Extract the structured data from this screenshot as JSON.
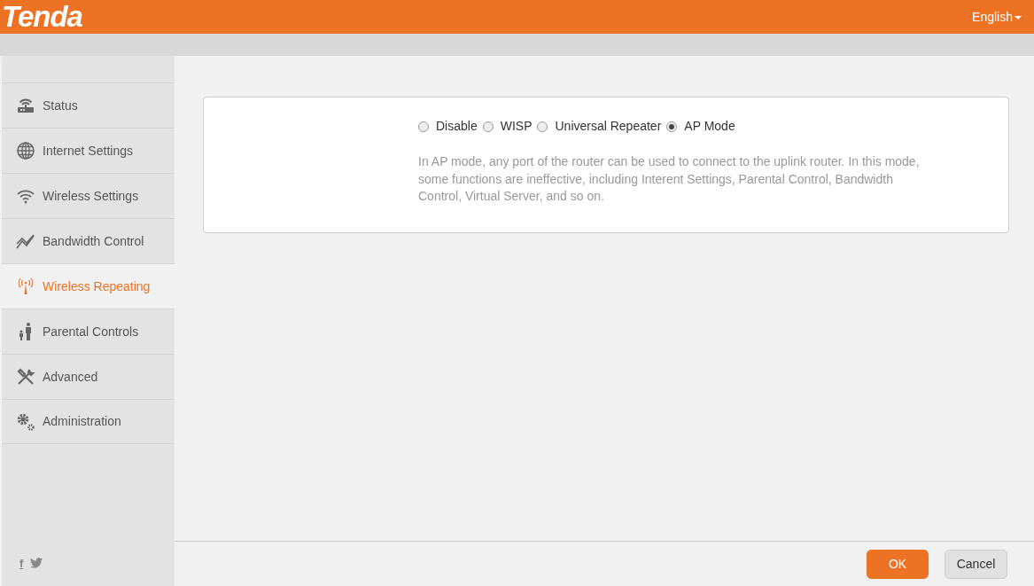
{
  "header": {
    "logo": "Tenda",
    "language": "English"
  },
  "sidebar": {
    "items": [
      {
        "label": "Status",
        "selected": false
      },
      {
        "label": "Internet Settings",
        "selected": false
      },
      {
        "label": "Wireless Settings",
        "selected": false
      },
      {
        "label": "Bandwidth Control",
        "selected": false
      },
      {
        "label": "Wireless Repeating",
        "selected": true
      },
      {
        "label": "Parental Controls",
        "selected": false
      },
      {
        "label": "Advanced",
        "selected": false
      },
      {
        "label": "Administration",
        "selected": false
      }
    ],
    "social": {
      "facebook": "f"
    }
  },
  "repeating": {
    "modes": [
      {
        "label": "Disable",
        "selected": false
      },
      {
        "label": "WISP",
        "selected": false
      },
      {
        "label": "Universal Repeater",
        "selected": false
      },
      {
        "label": "AP Mode",
        "selected": true
      }
    ],
    "description": "In AP mode, any port of the router can be used to connect to the uplink router. In this mode, some functions are ineffective, including Interent Settings, Parental Control, Bandwidth Control, Virtual Server, and so on."
  },
  "buttons": [
    {
      "label": "OK",
      "kind": "primary"
    },
    {
      "label": "Cancel",
      "kind": "secondary"
    }
  ]
}
